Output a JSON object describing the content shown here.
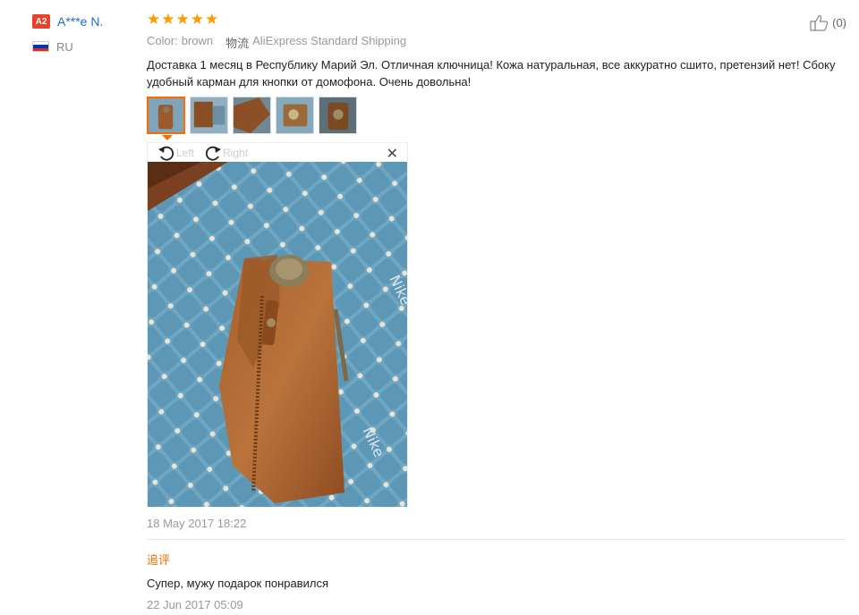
{
  "user": {
    "level_badge": "A2",
    "name": "A***e N.",
    "country": "RU",
    "flag_colors": [
      "#ffffff",
      "#0039a6",
      "#d52b1e"
    ]
  },
  "rating": {
    "stars": 5,
    "max": 5,
    "star_color": "#ff9a00"
  },
  "helpful": {
    "icon": "thumbs-up-icon",
    "count": "(0)"
  },
  "meta": {
    "color_label": "Color:",
    "color_value": "brown",
    "shipping_label": "物流",
    "shipping_value": "AliExpress Standard Shipping"
  },
  "review": {
    "text": "Доставка 1 месяц в Республику Марий Эл. Отличная ключница! Кожа натуральная, все аккуратно сшито, претензий нет! Сбоку удобный карман для кнопки от домофона. Очень довольна!",
    "date": "18 May 2017 18:22"
  },
  "thumbnails": [
    {
      "name": "photo-1",
      "active": true
    },
    {
      "name": "photo-2",
      "active": false
    },
    {
      "name": "photo-3",
      "active": false
    },
    {
      "name": "photo-4",
      "active": false
    },
    {
      "name": "photo-5",
      "active": false
    }
  ],
  "viewer": {
    "rotate_left_label": "Left",
    "rotate_right_label": "Right",
    "close_icon": "close-icon"
  },
  "followup": {
    "label": "追评",
    "text": "Супер, мужу подарок понравился",
    "date": "22 Jun 2017 05:09"
  },
  "accent_color": "#ff6a00",
  "link_color": "#1a6fd1"
}
